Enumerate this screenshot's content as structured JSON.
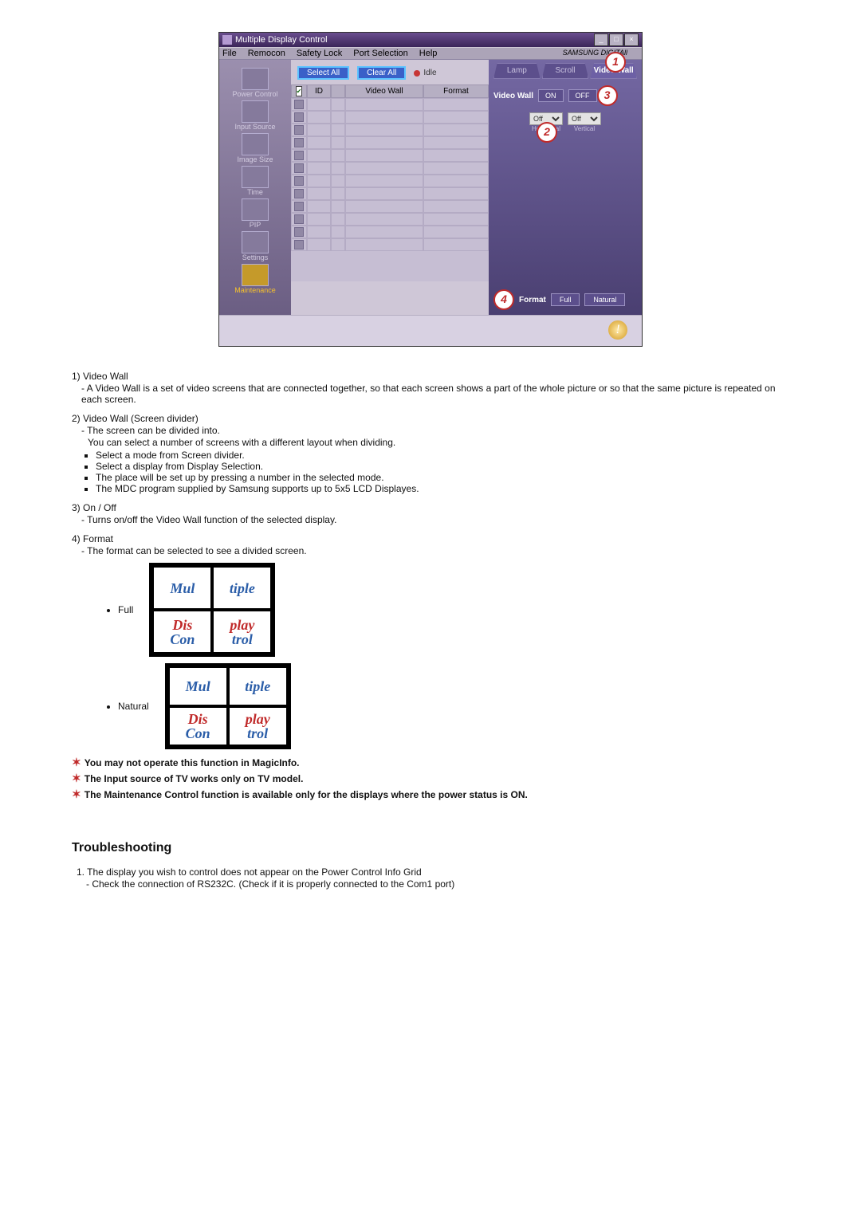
{
  "window": {
    "title": "Multiple Display Control",
    "menu": [
      "File",
      "Remocon",
      "Safety Lock",
      "Port Selection",
      "Help"
    ],
    "brand": "SAMSUNG DIGITAll"
  },
  "sidebar": {
    "items": [
      {
        "label": "Power Control"
      },
      {
        "label": "Input Source"
      },
      {
        "label": "Image Size"
      },
      {
        "label": "Time"
      },
      {
        "label": "PIP"
      },
      {
        "label": "Settings"
      },
      {
        "label": "Maintenance"
      }
    ]
  },
  "toolbar": {
    "select_all": "Select All",
    "clear_all": "Clear All",
    "idle": "Idle"
  },
  "grid": {
    "headers": {
      "chk": "",
      "id": "ID",
      "st": "",
      "vw": "Video Wall",
      "fm": "Format"
    },
    "row_count": 12
  },
  "rpanel": {
    "tabs": [
      "Lamp Control",
      "Scroll",
      "Video Wall"
    ],
    "active_tab": 2,
    "video_wall_label": "Video Wall",
    "on": "ON",
    "off": "OFF",
    "h_val": "Off",
    "h_lbl": "Horizontal",
    "v_val": "Off",
    "v_lbl": "Vertical",
    "format_label": "Format",
    "full": "Full",
    "natural": "Natural"
  },
  "callouts": {
    "c1": "1",
    "c2": "2",
    "c3": "3",
    "c4": "4"
  },
  "article": {
    "i1_title": "Video Wall",
    "i1_l1": "A Video Wall is a set of video screens that are connected together, so that each screen shows a part of the whole picture or so that the same picture is repeated on each screen.",
    "i2_title": "Video Wall (Screen divider)",
    "i2_l1": "The screen can be divided into.",
    "i2_l2": "You can select a number of screens with a different layout when dividing.",
    "i2_b1": "Select a mode from Screen divider.",
    "i2_b2": "Select a display from Display Selection.",
    "i2_b3": "The place will be set up by pressing a number in the selected mode.",
    "i2_b4": "The MDC program supplied by Samsung supports up to 5x5 LCD Displayes.",
    "i3_title": "On / Off",
    "i3_l1": "Turns on/off the Video Wall function of the selected display.",
    "i4_title": "Format",
    "i4_l1": "The format can be selected to see a divided screen.",
    "full_label": "Full",
    "natural_label": "Natural",
    "note1": "You may not operate this function in MagicInfo.",
    "note2": "The Input source of TV works only on TV model.",
    "note3": "The Maintenance Control function is available only for the displays where the power status is ON.",
    "ts_heading": "Troubleshooting",
    "ts_1": "The display you wish to control does not appear on the Power Control Info Grid",
    "ts_1a": "Check the connection of RS232C. (Check if it is properly connected to the Com1 port)"
  }
}
